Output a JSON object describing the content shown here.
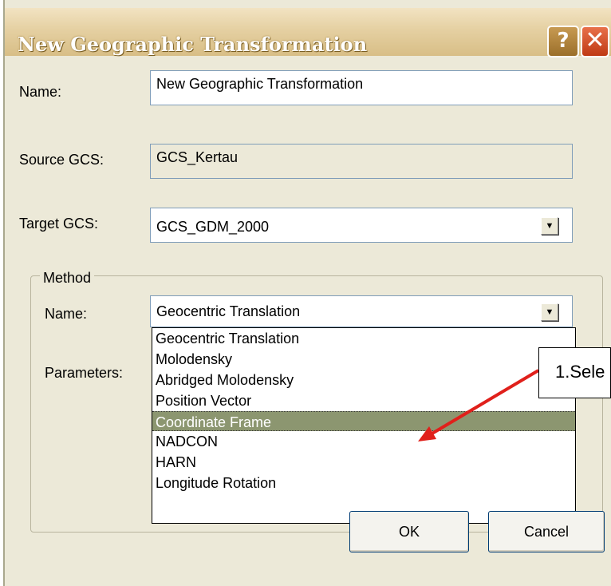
{
  "window": {
    "title": "New Geographic Transformation",
    "help_glyph": "?",
    "close_glyph": "✕"
  },
  "form": {
    "name_label": "Name:",
    "name_value": "New Geographic Transformation",
    "source_label": "Source GCS:",
    "source_value": "GCS_Kertau",
    "target_label": "Target GCS:",
    "target_value": "GCS_GDM_2000"
  },
  "method": {
    "group_title": "Method",
    "name_label": "Name:",
    "name_value": "Geocentric Translation",
    "parameters_label": "Parameters:",
    "options": [
      "Geocentric Translation",
      "Molodensky",
      "Abridged Molodensky",
      "Position Vector",
      "Coordinate Frame",
      "NADCON",
      "HARN",
      "Longitude Rotation"
    ],
    "selected_option": "Coordinate Frame"
  },
  "annotation": {
    "text": "1.Sele",
    "color": "#E0201B"
  },
  "buttons": {
    "ok": "OK",
    "cancel": "Cancel"
  },
  "icons": {
    "dropdown_arrow": "▼"
  }
}
